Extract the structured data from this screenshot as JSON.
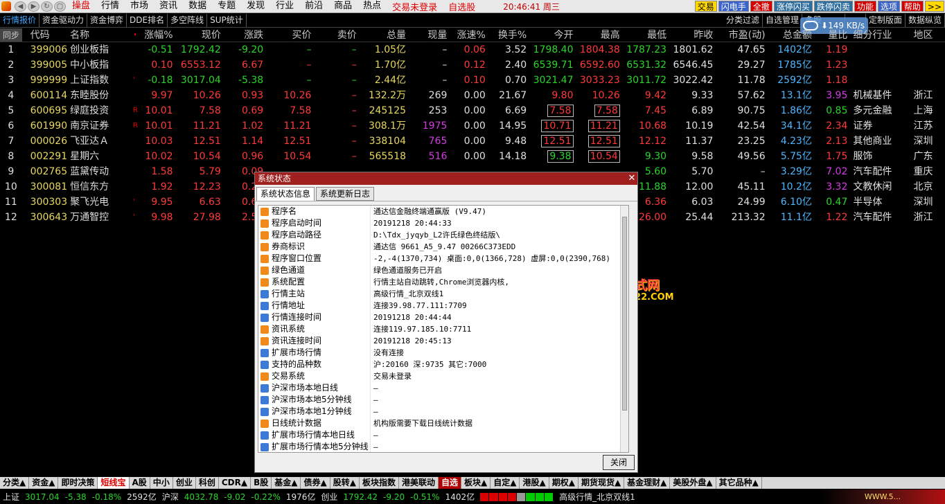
{
  "menubar": {
    "items": [
      "操盘",
      "行情",
      "市场",
      "资讯",
      "数据",
      "专题",
      "发现",
      "行业",
      "前沿",
      "商品",
      "热点"
    ],
    "trade_status": "交易未登录",
    "watchlist": "自选股",
    "clock": "20:46:41 周三",
    "buttons": [
      {
        "label": "交易",
        "style": "blue"
      },
      {
        "label": "闪电手",
        "style": "blue"
      },
      {
        "label": "全撤",
        "style": "red"
      },
      {
        "label": "涨停闪买",
        "style": "teal"
      },
      {
        "label": "跌停闪卖",
        "style": "teal"
      },
      {
        "label": "功能",
        "style": "red"
      },
      {
        "label": "选项",
        "style": "blue"
      },
      {
        "label": "帮助",
        "style": "red"
      },
      {
        "label": ">>",
        "style": "yellow"
      }
    ]
  },
  "subbar": {
    "tabs": [
      "行情报价",
      "资金驱动力",
      "资金博弈",
      "DDE排名",
      "多空阵线",
      "SUP统计"
    ],
    "right_tabs": [
      "分类过滤",
      "自选管理",
      "多股",
      "",
      "",
      "定制版面",
      "数据纵览"
    ],
    "speed": "149 KB/s"
  },
  "table": {
    "headers": [
      "同步",
      "代码",
      "名称",
      "涨幅%",
      "现价",
      "涨跌",
      "买价",
      "卖价",
      "总量",
      "现量",
      "涨速%",
      "换手%",
      "今开",
      "最高",
      "最低",
      "昨收",
      "市盈(动)",
      "总金额",
      "量比",
      "细分行业",
      "地区"
    ],
    "rows": [
      {
        "n": "1",
        "code": "399006",
        "name": "创业板指",
        "mark": "",
        "chg_pct": "-0.51",
        "price": "1792.42",
        "chg": "-9.20",
        "bid": "–",
        "ask": "–",
        "vol": "1.05亿",
        "cur": "–",
        "spd": "0.06",
        "turn": "3.52",
        "open": "1798.40",
        "high": "1804.38",
        "low": "1787.23",
        "prev": "1801.62",
        "pe": "47.65",
        "amt": "1402亿",
        "ratio": "1.19",
        "ind": "",
        "area": "",
        "dir": "dn"
      },
      {
        "n": "2",
        "code": "399005",
        "name": "中小板指",
        "mark": "",
        "chg_pct": "0.10",
        "price": "6553.12",
        "chg": "6.67",
        "bid": "–",
        "ask": "–",
        "vol": "1.70亿",
        "cur": "–",
        "spd": "0.12",
        "turn": "2.40",
        "open": "6539.71",
        "high": "6592.60",
        "low": "6531.32",
        "prev": "6546.45",
        "pe": "29.27",
        "amt": "1785亿",
        "ratio": "1.23",
        "ind": "",
        "area": "",
        "dir": "up"
      },
      {
        "n": "3",
        "code": "999999",
        "name": "上证指数",
        "mark": "'",
        "chg_pct": "-0.18",
        "price": "3017.04",
        "chg": "-5.38",
        "bid": "–",
        "ask": "–",
        "vol": "2.44亿",
        "cur": "–",
        "spd": "0.10",
        "turn": "0.70",
        "open": "3021.47",
        "high": "3033.23",
        "low": "3011.72",
        "prev": "3022.42",
        "pe": "11.78",
        "amt": "2592亿",
        "ratio": "1.18",
        "ind": "",
        "area": "",
        "dir": "dn"
      },
      {
        "n": "4",
        "code": "600114",
        "name": "东睦股份",
        "mark": "",
        "chg_pct": "9.97",
        "price": "10.26",
        "chg": "0.93",
        "bid": "10.26",
        "ask": "–",
        "vol": "132.2万",
        "cur": "269",
        "spd": "0.00",
        "turn": "21.67",
        "open": "9.80",
        "high": "10.26",
        "low": "9.42",
        "prev": "9.33",
        "pe": "57.62",
        "amt": "13.1亿",
        "ratio": "3.95",
        "ind": "机械基件",
        "area": "浙江",
        "dir": "up"
      },
      {
        "n": "5",
        "code": "600695",
        "name": "绿庭投资",
        "mark": "R",
        "chg_pct": "10.01",
        "price": "7.58",
        "chg": "0.69",
        "bid": "7.58",
        "ask": "–",
        "vol": "245125",
        "cur": "253",
        "spd": "0.00",
        "turn": "6.69",
        "open": "7.58",
        "high": "7.58",
        "low": "7.45",
        "prev": "6.89",
        "pe": "90.75",
        "amt": "1.86亿",
        "ratio": "0.85",
        "ind": "多元金融",
        "area": "上海",
        "dir": "up"
      },
      {
        "n": "6",
        "code": "601990",
        "name": "南京证券",
        "mark": "R",
        "chg_pct": "10.01",
        "price": "11.21",
        "chg": "1.02",
        "bid": "11.21",
        "ask": "–",
        "vol": "308.1万",
        "cur": "1975",
        "spd": "0.00",
        "turn": "14.95",
        "open": "10.71",
        "high": "11.21",
        "low": "10.68",
        "prev": "10.19",
        "pe": "42.54",
        "amt": "34.1亿",
        "ratio": "2.34",
        "ind": "证券",
        "area": "江苏",
        "dir": "up"
      },
      {
        "n": "7",
        "code": "000026",
        "name": "飞亚达Ａ",
        "mark": "",
        "chg_pct": "10.03",
        "price": "12.51",
        "chg": "1.14",
        "bid": "12.51",
        "ask": "–",
        "vol": "338104",
        "cur": "765",
        "spd": "0.00",
        "turn": "9.48",
        "open": "12.51",
        "high": "12.51",
        "low": "12.12",
        "prev": "11.37",
        "pe": "23.25",
        "amt": "4.23亿",
        "ratio": "2.13",
        "ind": "其他商业",
        "area": "深圳",
        "dir": "up"
      },
      {
        "n": "8",
        "code": "002291",
        "name": "星期六",
        "mark": "",
        "chg_pct": "10.02",
        "price": "10.54",
        "chg": "0.96",
        "bid": "10.54",
        "ask": "–",
        "vol": "565518",
        "cur": "516",
        "spd": "0.00",
        "turn": "14.18",
        "open": "9.38",
        "high": "10.54",
        "low": "9.30",
        "prev": "9.58",
        "pe": "49.56",
        "amt": "5.75亿",
        "ratio": "1.75",
        "ind": "服饰",
        "area": "广东",
        "dir": "up"
      },
      {
        "n": "9",
        "code": "002765",
        "name": "蓝黛传动",
        "mark": "",
        "chg_pct": "1.58",
        "price": "5.79",
        "chg": "0.09",
        "bid": "",
        "ask": "",
        "vol": "",
        "cur": "",
        "spd": "",
        "turn": "",
        "open": "",
        "high": "",
        "low": "5.60",
        "prev": "5.70",
        "pe": "–",
        "amt": "3.29亿",
        "ratio": "7.02",
        "ind": "汽车配件",
        "area": "重庆",
        "dir": "up"
      },
      {
        "n": "10",
        "code": "300081",
        "name": "恒信东方",
        "mark": "",
        "chg_pct": "1.92",
        "price": "12.23",
        "chg": "0.23",
        "bid": "",
        "ask": "",
        "vol": "",
        "cur": "",
        "spd": "",
        "turn": "",
        "open": "",
        "high": "",
        "low": "11.88",
        "prev": "12.00",
        "pe": "45.11",
        "amt": "10.2亿",
        "ratio": "3.32",
        "ind": "文教休闲",
        "area": "北京",
        "dir": "up"
      },
      {
        "n": "11",
        "code": "300303",
        "name": "聚飞光电",
        "mark": "'",
        "chg_pct": "9.95",
        "price": "6.63",
        "chg": "0.60",
        "bid": "",
        "ask": "",
        "vol": "",
        "cur": "",
        "spd": "",
        "turn": "",
        "open": "",
        "high": "",
        "low": "6.36",
        "prev": "6.03",
        "pe": "24.99",
        "amt": "6.10亿",
        "ratio": "0.47",
        "ind": "半导体",
        "area": "深圳",
        "dir": "up"
      },
      {
        "n": "12",
        "code": "300643",
        "name": "万通智控",
        "mark": "'",
        "chg_pct": "9.98",
        "price": "27.98",
        "chg": "2.54",
        "bid": "",
        "ask": "",
        "vol": "",
        "cur": "",
        "spd": "",
        "turn": "",
        "open": "",
        "high": "",
        "low": "26.00",
        "prev": "25.44",
        "pe": "213.32",
        "amt": "11.1亿",
        "ratio": "1.22",
        "ind": "汽车配件",
        "area": "浙江",
        "dir": "up"
      }
    ]
  },
  "dialog": {
    "title": "系统状态",
    "tabs": [
      "系统状态信息",
      "系统更新日志"
    ],
    "close_label": "关闭",
    "items": [
      {
        "k": "程序名",
        "v": "通达信金融终端通赢版 (V9.47)",
        "icon": "o"
      },
      {
        "k": "程序启动时间",
        "v": "20191218 20:44:33",
        "icon": "o"
      },
      {
        "k": "程序启动路径",
        "v": "D:\\Tdx_jyqyb_L2许氏绿色终结版\\",
        "icon": "o"
      },
      {
        "k": "券商标识",
        "v": "通达信 9661_A5_9.47 00266C373EDD",
        "icon": "o"
      },
      {
        "k": "程序窗口位置",
        "v": "-2,-4(1370,734) 桌面:0,0(1366,728) 虚屏:0,0(2390,768)",
        "icon": "o"
      },
      {
        "k": "绿色通道",
        "v": "绿色通道服务已开启",
        "icon": "o"
      },
      {
        "k": "系统配置",
        "v": "行情主站自动跳转,Chrome浏览器内核,",
        "icon": "o"
      },
      {
        "k": "行情主站",
        "v": "高级行情_北京双线1",
        "icon": "b"
      },
      {
        "k": "行情地址",
        "v": "连接39.98.77.111:7709",
        "icon": "b"
      },
      {
        "k": "行情连接时间",
        "v": "20191218 20:44:44",
        "icon": "b"
      },
      {
        "k": "资讯系统",
        "v": "连接119.97.185.10:7711",
        "icon": "o"
      },
      {
        "k": "资讯连接时间",
        "v": "20191218 20:45:13",
        "icon": "o"
      },
      {
        "k": "扩展市场行情",
        "v": "没有连接",
        "icon": "b"
      },
      {
        "k": "支持的品种数",
        "v": "沪:20160 深:9735 其它:7000",
        "icon": "b"
      },
      {
        "k": "交易系统",
        "v": "交易未登录",
        "icon": "o"
      },
      {
        "k": "沪深市场本地日线",
        "v": "—",
        "icon": "b"
      },
      {
        "k": "沪深市场本地5分钟线",
        "v": "—",
        "icon": "b"
      },
      {
        "k": "沪深市场本地1分钟线",
        "v": "—",
        "icon": "b"
      },
      {
        "k": "日线统计数据",
        "v": "机构版需要下载日线统计数据",
        "icon": "o"
      },
      {
        "k": "扩展市场行情本地日线",
        "v": "—",
        "icon": "b"
      },
      {
        "k": "扩展市场行情本地5分钟线",
        "v": "—",
        "icon": "b"
      }
    ]
  },
  "watermark": {
    "line1": "分析家公式网",
    "line2": "WWW.70822.COM"
  },
  "bottom_tabs": [
    {
      "label": "分类▲",
      "style": ""
    },
    {
      "label": "资金▲",
      "style": ""
    },
    {
      "label": "即时决策",
      "style": ""
    },
    {
      "label": "短线宝",
      "style": "new"
    },
    {
      "label": "A股",
      "style": ""
    },
    {
      "label": "中小",
      "style": ""
    },
    {
      "label": "创业",
      "style": ""
    },
    {
      "label": "科创",
      "style": ""
    },
    {
      "label": "CDR▲",
      "style": ""
    },
    {
      "label": "B股",
      "style": ""
    },
    {
      "label": "基金▲",
      "style": ""
    },
    {
      "label": "债券▲",
      "style": ""
    },
    {
      "label": "股转▲",
      "style": ""
    },
    {
      "label": "板块指数",
      "style": ""
    },
    {
      "label": "港美联动",
      "style": ""
    },
    {
      "label": "自选",
      "style": "active"
    },
    {
      "label": "板块▲",
      "style": ""
    },
    {
      "label": "自定▲",
      "style": ""
    },
    {
      "label": "港股▲",
      "style": ""
    },
    {
      "label": "期权▲",
      "style": ""
    },
    {
      "label": "期货现货▲",
      "style": ""
    },
    {
      "label": "基金理财▲",
      "style": ""
    },
    {
      "label": "美股外盘▲",
      "style": ""
    },
    {
      "label": "其它品种▲",
      "style": ""
    }
  ],
  "statusbar": {
    "sh_label": "上证",
    "sh_price": "3017.04",
    "sh_chg": "-5.38",
    "sh_pct": "-0.18%",
    "sh_amt": "2592亿",
    "hs_label": "沪深",
    "hs_price": "4032.78",
    "hs_chg": "-9.02",
    "hs_pct": "-0.22%",
    "hs_amt": "1976亿",
    "cy_label": "创业",
    "cy_price": "1792.42",
    "cy_chg": "-9.20",
    "cy_pct": "-0.51%",
    "cy_amt": "1402亿",
    "server": "高级行情_北京双线1",
    "logo_text": "WWW.5..."
  },
  "colors": {
    "up": "#ff3a3a",
    "down": "#2bd52b",
    "accent": "#b00000"
  }
}
